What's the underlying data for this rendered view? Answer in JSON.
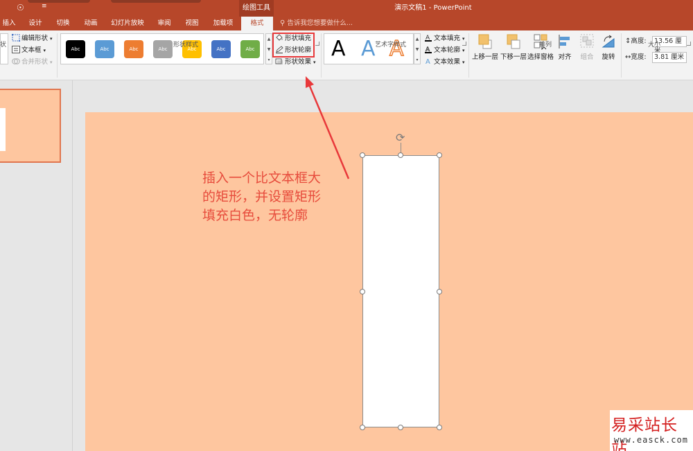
{
  "window": {
    "title": "演示文稿1 - PowerPoint",
    "contextual_tab_group": "绘图工具"
  },
  "tabs": [
    {
      "label": "插入"
    },
    {
      "label": "设计"
    },
    {
      "label": "切换"
    },
    {
      "label": "动画"
    },
    {
      "label": "幻灯片放映"
    },
    {
      "label": "审阅"
    },
    {
      "label": "视图"
    },
    {
      "label": "加载项"
    },
    {
      "label": "格式",
      "active": true
    }
  ],
  "tell_me": "告诉我您想要做什么...",
  "ribbon": {
    "insert_shapes": {
      "edit_shape": "编辑形状",
      "text_box": "文本框",
      "merge_shapes": "合并形状",
      "group_label_partial": "状"
    },
    "shape_styles": {
      "group_label": "形状样式",
      "swatch_text": "Abc",
      "swatch_colors": [
        "#000000",
        "#5b9bd5",
        "#ed7d31",
        "#a5a5a5",
        "#ffc000",
        "#4472c4",
        "#70ad47"
      ],
      "fill": "形状填充",
      "outline": "形状轮廓",
      "effects": "形状效果"
    },
    "wordart_styles": {
      "group_label": "艺术字样式",
      "letter": "A",
      "text_fill": "文本填充",
      "text_outline": "文本轮廓",
      "text_effects": "文本效果"
    },
    "arrange": {
      "group_label": "排列",
      "bring_forward": "上移一层",
      "send_backward": "下移一层",
      "selection_pane": "选择窗格",
      "align": "对齐",
      "group": "组合",
      "rotate": "旋转"
    },
    "size": {
      "group_label": "大小",
      "height_label": "高度:",
      "height_value": "13.56 厘米",
      "width_label": "宽度:",
      "width_value": "3.81 厘米"
    }
  },
  "annotation": {
    "line1": "插入一个比文本框大",
    "line2": "的矩形，并设置矩形",
    "line3": "填充白色，无轮廓"
  },
  "watermark": {
    "title": "易采站长站",
    "url": "www.easck.com"
  },
  "colors": {
    "accent": "#b7472a",
    "slide_bg": "#fec69f",
    "annotation": "#e74c3c",
    "highlight": "#e8383a"
  }
}
